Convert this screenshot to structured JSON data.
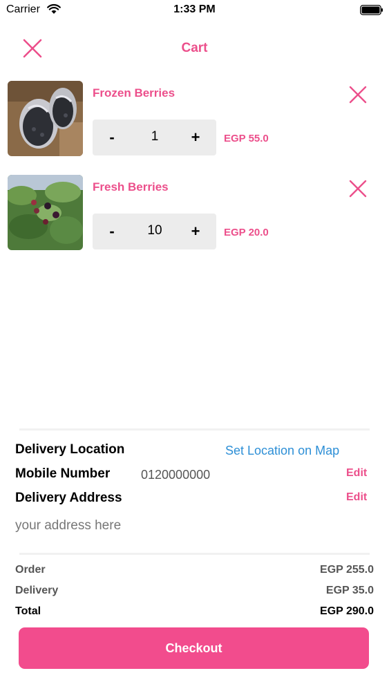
{
  "status_bar": {
    "carrier": "Carrier",
    "time": "1:33 PM"
  },
  "header": {
    "title": "Cart",
    "close_icon": "close-icon"
  },
  "cart": {
    "items": [
      {
        "name": "Frozen Berries",
        "quantity": "1",
        "price": "EGP 55.0",
        "minus_label": "-",
        "plus_label": "+"
      },
      {
        "name": "Fresh Berries",
        "quantity": "10",
        "price": "EGP 20.0",
        "minus_label": "-",
        "plus_label": "+"
      }
    ]
  },
  "delivery": {
    "location_label": "Delivery Location",
    "location_link": "Set Location on Map",
    "mobile_label": "Mobile Number",
    "mobile_value": "0120000000",
    "mobile_edit": "Edit",
    "address_label": "Delivery Address",
    "address_edit": "Edit",
    "address_placeholder": "your address here"
  },
  "summary": {
    "order_label": "Order",
    "order_value": "EGP 255.0",
    "delivery_label": "Delivery",
    "delivery_value": "EGP 35.0",
    "total_label": "Total",
    "total_value": "EGP 290.0"
  },
  "checkout": {
    "label": "Checkout"
  },
  "colors": {
    "accent": "#ec4f8b",
    "button": "#f24c8d",
    "link": "#2d8fd6",
    "stepper_bg": "#ececec"
  }
}
